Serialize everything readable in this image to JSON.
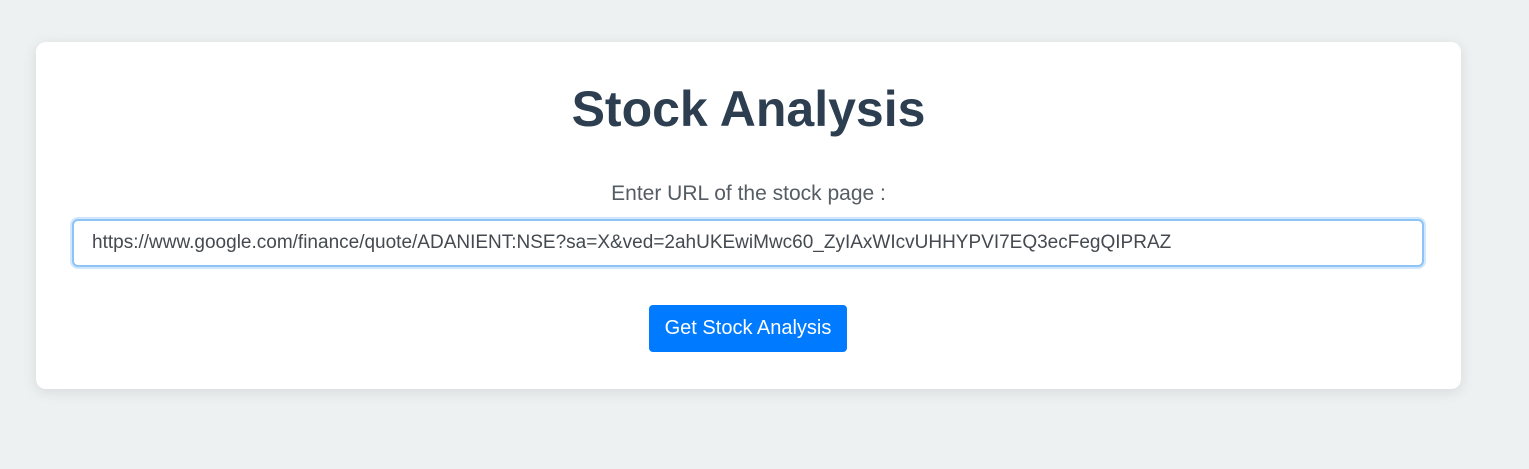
{
  "page": {
    "title": "Stock Analysis",
    "url_label": "Enter URL of the stock page :",
    "url_input": {
      "value": "https://www.google.com/finance/quote/ADANIENT:NSE?sa=X&ved=2ahUKEwiMwc60_ZyIAxWIcvUHHYPVI7EQ3ecFegQIPRAZ",
      "placeholder": ""
    },
    "submit_label": "Get Stock Analysis"
  },
  "colors": {
    "background": "#eef1f2",
    "card": "#ffffff",
    "title": "#2c3e50",
    "accent": "#007bff",
    "input_focus_border": "#8ec3f5"
  }
}
